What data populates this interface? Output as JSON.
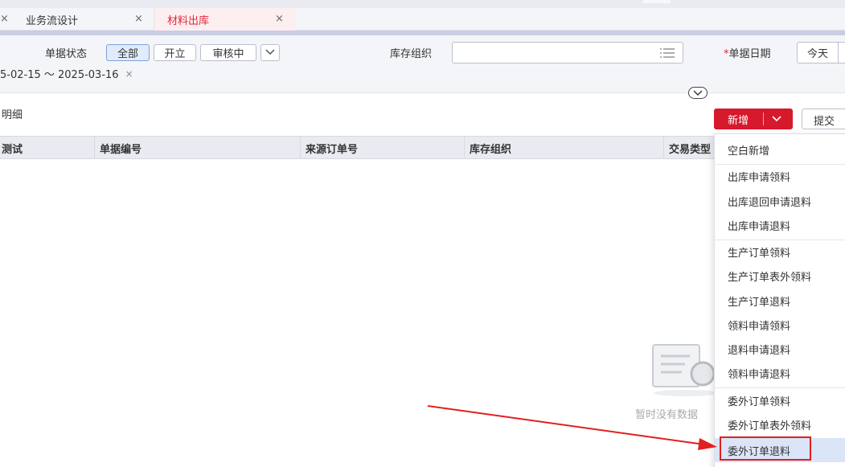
{
  "tabs": {
    "prev_close": "×",
    "items": [
      {
        "label": "业务流设计",
        "close": "×"
      },
      {
        "label": "材料出库",
        "close": "×"
      }
    ]
  },
  "filters": {
    "status_label": "单据状态",
    "status_options": [
      "全部",
      "开立",
      "审核中"
    ],
    "org_label": "库存组织",
    "date_label": "单据日期",
    "required_mark": "*",
    "today_btn": "今天",
    "date_range": "5-02-15 ～ 2025-03-16",
    "date_range_clear": "×"
  },
  "section": {
    "title": "明细"
  },
  "toolbar": {
    "new_label": "新增",
    "submit_label": "提交"
  },
  "table": {
    "columns": [
      "测试",
      "单据编号",
      "来源订单号",
      "库存组织",
      "交易类型"
    ]
  },
  "empty": {
    "text": "暂时没有数据"
  },
  "dropdown": {
    "groups": [
      [
        "空白新增"
      ],
      [
        "出库申请领料",
        "出库退回申请退料",
        "出库申请退料"
      ],
      [
        "生产订单领料",
        "生产订单表外领料",
        "生产订单退料",
        "领料申请领料",
        "退料申请退料",
        "领料申请退料"
      ],
      [
        "委外订单领料",
        "委外订单表外领料",
        "委外订单退料"
      ]
    ],
    "highlighted": "委外订单退料"
  },
  "colors": {
    "brand": "#d7192c",
    "active_tab_text": "#e0283a",
    "highlight_box": "#e02020",
    "annotation_arrow": "#e02020"
  }
}
